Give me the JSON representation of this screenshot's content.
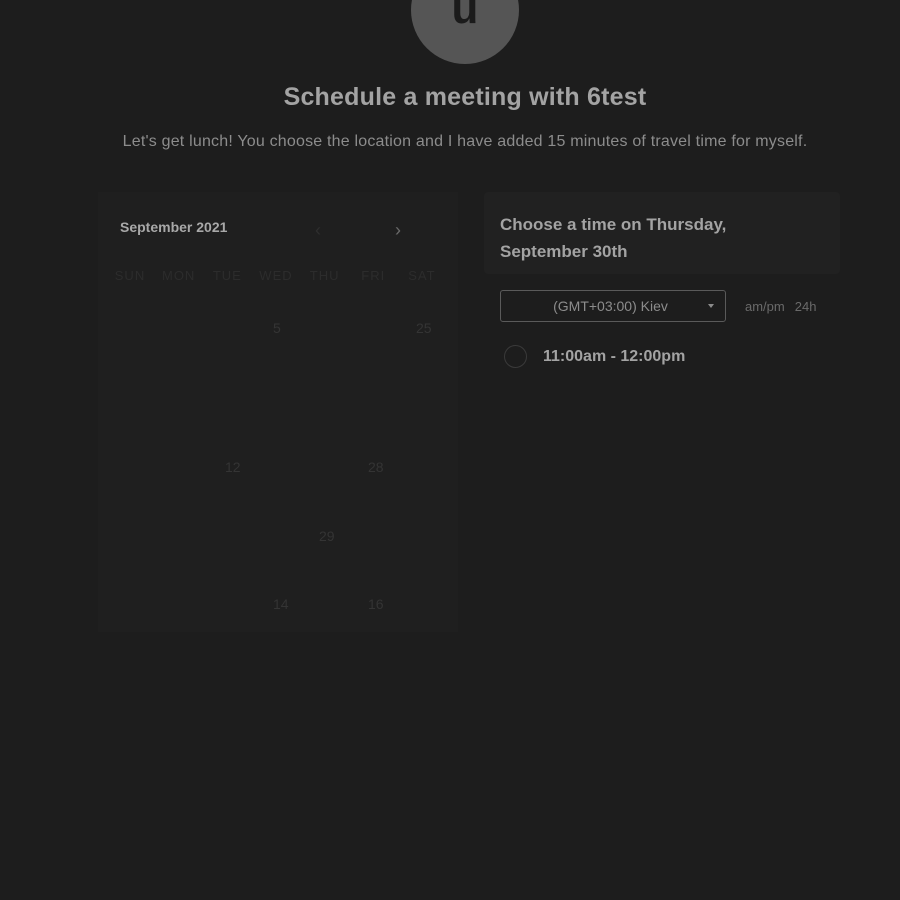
{
  "host": {
    "avatar_letter": "u",
    "title": "Schedule a meeting with 6test",
    "description": "Let's get lunch! You choose the location and I have added 15 minutes of travel time for myself."
  },
  "calendar": {
    "month_label": "September 2021",
    "prev_icon": "chevron-left-icon",
    "next_icon": "chevron-right-icon",
    "weekdays": [
      "SUN",
      "MON",
      "TUE",
      "WED",
      "THU",
      "FRI",
      "SAT"
    ],
    "days": [
      "5",
      "25",
      "12",
      "28",
      "29",
      "14",
      "16"
    ]
  },
  "times": {
    "title": "Choose a time on Thursday, September 30th",
    "timezone": "(GMT+03:00) Kiev",
    "format_ampm": "am/pm",
    "format_24h": "24h",
    "slots": [
      "11:00am - 12:00pm"
    ]
  },
  "colors": {
    "background": "#1d1d1d",
    "text_primary": "#a3a3a3",
    "text_muted": "#8c8c8c"
  }
}
